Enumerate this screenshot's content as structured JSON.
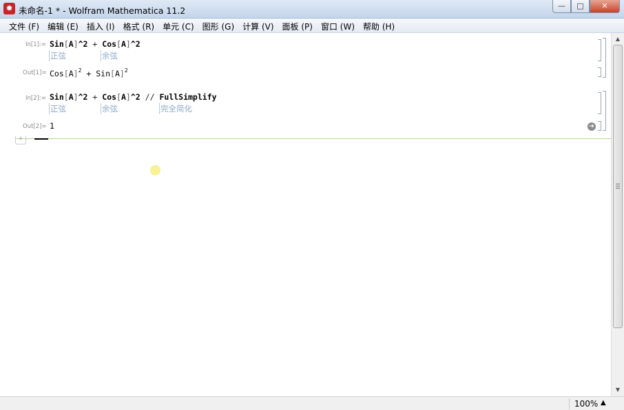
{
  "window": {
    "title": "未命名-1 * - Wolfram Mathematica 11.2",
    "app_icon": "mathematica-spikey-icon",
    "minimize": "—",
    "maximize": "□",
    "close": "✕"
  },
  "menu": [
    "文件 (F)",
    "编辑 (E)",
    "插入 (I)",
    "格式 (R)",
    "单元 (C)",
    "图形 (G)",
    "计算 (V)",
    "面板 (P)",
    "窗口 (W)",
    "帮助 (H)"
  ],
  "cells": {
    "in1": {
      "label": "In[1]:=",
      "sin": "Sin",
      "lb1": "[",
      "a1": "A",
      "rb1": "]",
      "pow1": "^2",
      "plus": "+",
      "cos": "Cos",
      "lb2": "[",
      "a2": "A",
      "rb2": "]",
      "pow2": "^2",
      "hint_sin": "正弦",
      "hint_cos": "余弦"
    },
    "out1": {
      "label": "Out[1]=",
      "cos": "Cos",
      "lb1": "[",
      "a1": "A",
      "rb1": "]",
      "exp1": "2",
      "plus": "+",
      "sin": "Sin",
      "lb2": "[",
      "a2": "A",
      "rb2": "]",
      "exp2": "2"
    },
    "in2": {
      "label": "In[2]:=",
      "sin": "Sin",
      "lb1": "[",
      "a1": "A",
      "rb1": "]",
      "pow1": "^2",
      "plus": "+",
      "cos": "Cos",
      "lb2": "[",
      "a2": "A",
      "rb2": "]",
      "pow2": "^2",
      "postfix": "//",
      "fn": "FullSimplify",
      "hint_sin": "正弦",
      "hint_cos": "余弦",
      "hint_fn": "完全简化"
    },
    "out2": {
      "label": "Out[2]=",
      "value": "1"
    }
  },
  "status": {
    "zoom": "100%",
    "zoom_arrow": "▲"
  },
  "scrollbar": {
    "up": "▲",
    "down": "▼"
  }
}
